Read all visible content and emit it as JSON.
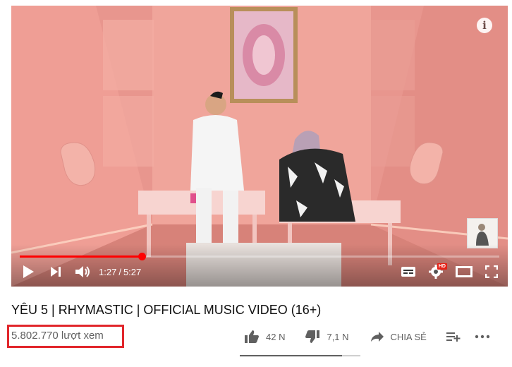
{
  "player": {
    "info_icon": "info-icon",
    "progress_fraction": 0.255,
    "current_time": "1:27",
    "duration": "5:27",
    "time_separator": "/",
    "hd_badge": "HD",
    "icons": [
      "play-icon",
      "next-icon",
      "volume-icon",
      "subtitles-icon",
      "settings-icon",
      "theater-mode-icon",
      "fullscreen-icon"
    ],
    "accent_color": "#ff0000"
  },
  "video": {
    "title": "YÊU 5 | RHYMASTIC | OFFICIAL MUSIC VIDEO (16+)",
    "views": "5.802.770 lượt xem"
  },
  "actions": {
    "like_count": "42 N",
    "dislike_count": "7,1 N",
    "share_label": "CHIA SẺ",
    "like_ratio": 0.85
  },
  "colors": {
    "highlight_box": "#e1262b",
    "scene_pink": "#e99a92"
  }
}
